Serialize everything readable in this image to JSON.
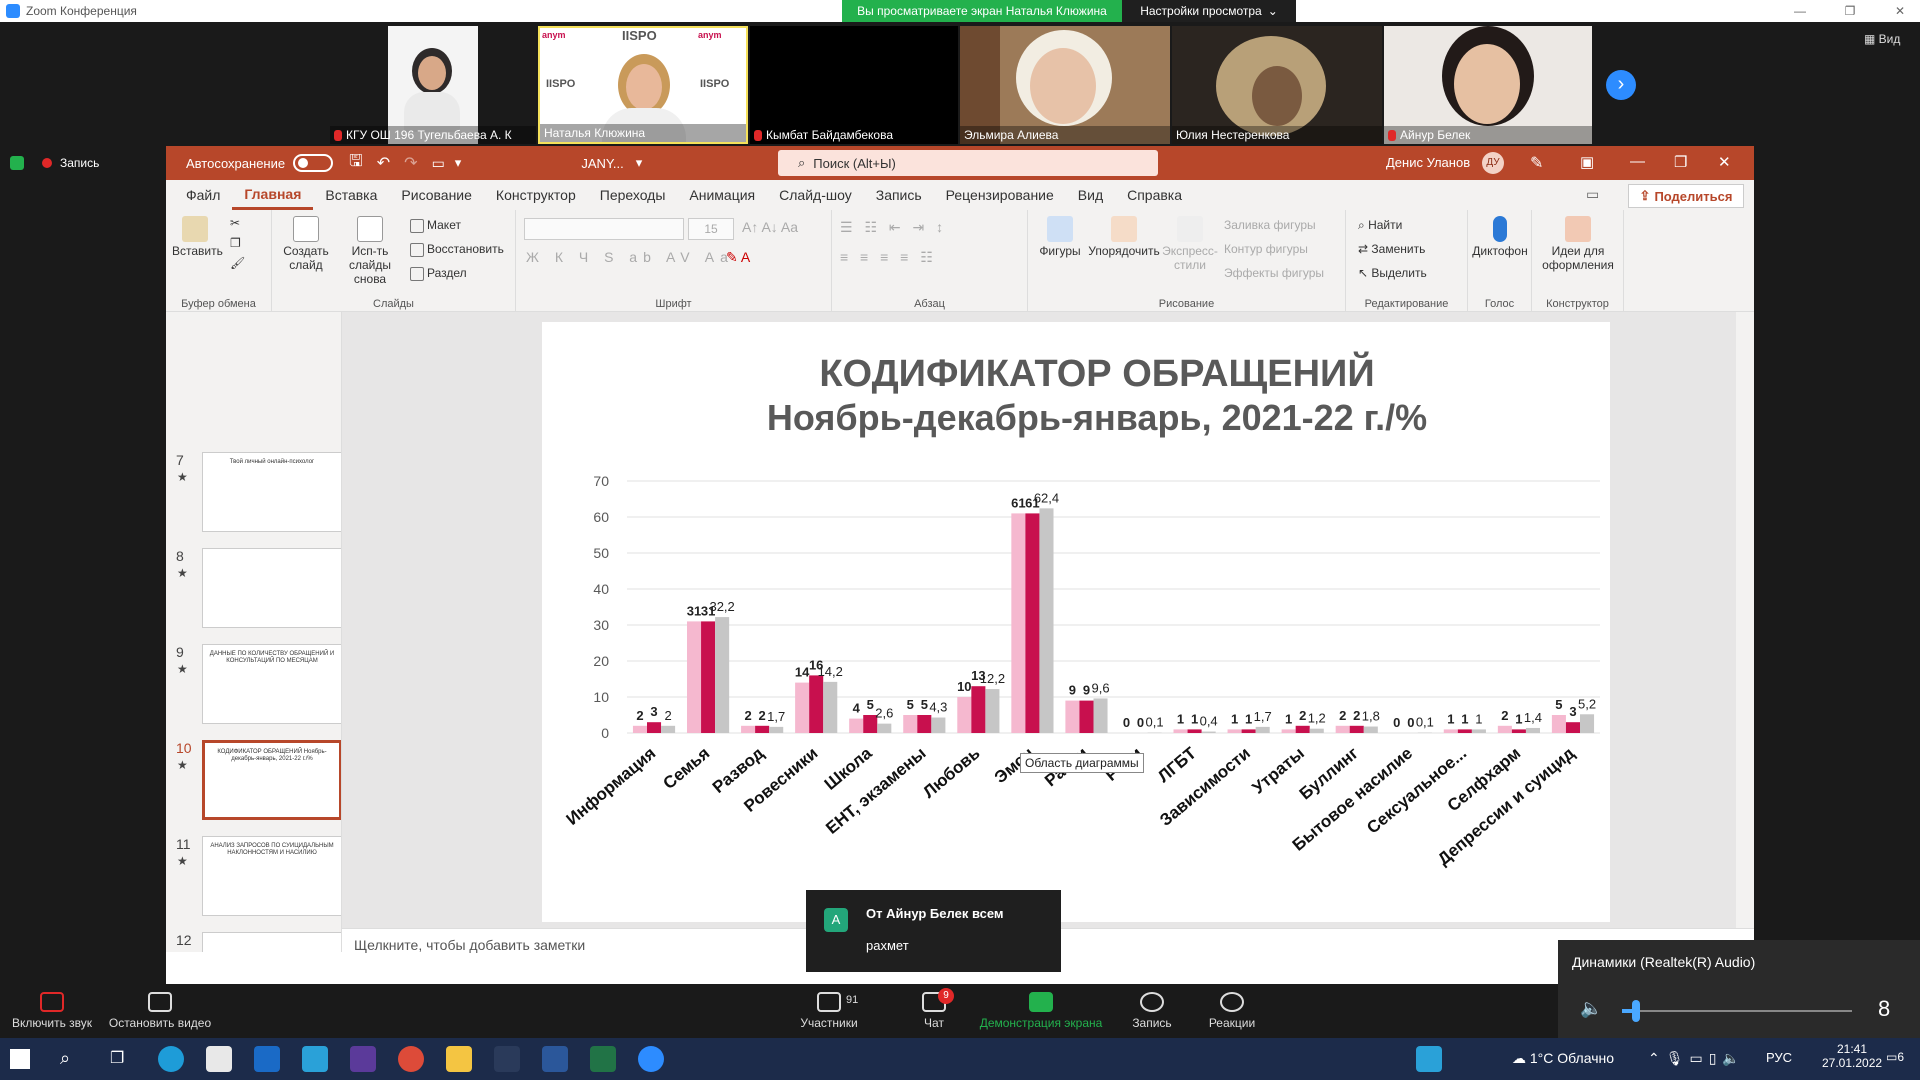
{
  "zoom": {
    "title": "Zoom Конференция",
    "viewing_banner": "Вы просматриваете экран Наталья Клюжина",
    "view_options": "Настройки просмотра",
    "view_button": "Вид",
    "record_label": "Запись",
    "participants": [
      {
        "name": "КГУ ОШ 196 Тугельбаева А. К",
        "muted": true
      },
      {
        "name": "Наталья Клюжина",
        "muted": false
      },
      {
        "name": "Кымбат Байдамбекова",
        "muted": true
      },
      {
        "name": "Эльмира Алиева",
        "muted": false
      },
      {
        "name": "Юлия Нестеренкова",
        "muted": false
      },
      {
        "name": "Айнур Белек",
        "muted": true
      }
    ],
    "tile_logo_text": "IISPO",
    "tile_logo_side": "anym",
    "bottom": {
      "mute": "Включить звук",
      "video": "Остановить видео",
      "participants": "Участники",
      "participants_count": "91",
      "chat": "Чат",
      "chat_badge": "9",
      "share": "Демонстрация экрана",
      "record": "Запись",
      "reactions": "Реакции"
    },
    "chat_popup": {
      "avatar": "А",
      "from": "От Айнур Белек всем",
      "message": "рахмет"
    },
    "audio_popup": {
      "device": "Динамики (Realtek(R) Audio)",
      "volume": "8",
      "level": 0.06
    }
  },
  "ppt": {
    "autosave": "Автосохранение",
    "filename": "JANY...",
    "search": "Поиск (Alt+Ы)",
    "user": "Денис Уланов",
    "user_initials": "ДУ",
    "share": "Поделиться",
    "menu": [
      "Файл",
      "Главная",
      "Вставка",
      "Рисование",
      "Конструктор",
      "Переходы",
      "Анимация",
      "Слайд-шоу",
      "Запись",
      "Рецензирование",
      "Вид",
      "Справка"
    ],
    "active_menu": 1,
    "ribbon": {
      "paste": "Вставить",
      "clipboard": "Буфер обмена",
      "new_slide": "Создать слайд",
      "reuse": "Исп-ть слайды снова",
      "layout": "Макет",
      "reset": "Восстановить",
      "section": "Раздел",
      "slides": "Слайды",
      "font_size": "15",
      "font": "Шрифт",
      "paragraph": "Абзац",
      "shapes": "Фигуры",
      "arrange": "Упорядочить",
      "quick_styles": "Экспресс-стили",
      "fill": "Заливка фигуры",
      "outline": "Контур фигуры",
      "effects": "Эффекты фигуры",
      "drawing": "Рисование",
      "find": "Найти",
      "replace": "Заменить",
      "select": "Выделить",
      "editing": "Редактирование",
      "dictate": "Диктофон",
      "voice": "Голос",
      "designer_ideas": "Идеи для оформления",
      "designer": "Конструктор"
    },
    "thumbs": [
      {
        "num": "7",
        "title": "Твой личный онлайн-психолог"
      },
      {
        "num": "8",
        "title": ""
      },
      {
        "num": "9",
        "title": "ДАННЫЕ ПО КОЛИЧЕСТВУ ОБРАЩЕНИЙ И КОНСУЛЬТАЦИЙ ПО МЕСЯЦАМ"
      },
      {
        "num": "10",
        "title": "КОДИФИКАТОР ОБРАЩЕНИЙ Ноябрь-декабрь-январь, 2021-22 г./%"
      },
      {
        "num": "11",
        "title": "АНАЛИЗ ЗАПРОСОВ ПО СУИЦИДАЛЬНЫМ НАКЛОННОСТЯМ И НАСИЛИЮ"
      },
      {
        "num": "12",
        "title": ""
      }
    ],
    "selected_thumb": "10",
    "notes": "Щелкните, чтобы добавить заметки",
    "tooltip": "Область диаграммы"
  },
  "chart_data": {
    "type": "bar",
    "title": "КОДИФИКАТОР ОБРАЩЕНИЙ",
    "subtitle": "Ноябрь-декабрь-январь, 2021-22 г./%",
    "ylim": [
      0,
      70
    ],
    "yticks": [
      0,
      10,
      20,
      30,
      40,
      50,
      60,
      70
    ],
    "grid": true,
    "categories": [
      "Информация",
      "Семья",
      "Развод",
      "Ровесники",
      "Школа",
      "ЕНТ, экзамены",
      "Любовь",
      "Эмоции",
      "Развитие",
      "Религия",
      "ЛГБТ",
      "Зависимости",
      "Утраты",
      "Буллинг",
      "Бытовое насилие",
      "Сексуальное...",
      "Селфхарм",
      "Депрессии и суицид"
    ],
    "category_labels": [
      "Информация",
      "Семья",
      "Развод",
      "Ровесники",
      "Школа",
      "ЕНТ, экзамены",
      "Любовь",
      "Эмоц",
      "Разви",
      "Рели",
      "ЛГБТ",
      "Зависимости",
      "Утраты",
      "Буллинг",
      "Бытовое насилие",
      "Сексуальное...",
      "Селфхарм",
      "Депрессии и суицид"
    ],
    "series": [
      {
        "values": [
          2,
          31,
          2,
          14,
          4,
          5,
          10,
          61,
          9,
          0,
          1,
          1,
          1,
          2,
          0,
          1,
          2,
          5
        ],
        "labels": [
          "2",
          "31",
          "2",
          "14",
          "4",
          "5",
          "10",
          "61",
          "9",
          "0",
          "1",
          "1",
          "1",
          "2",
          "0",
          "1",
          "2",
          "5"
        ],
        "color": "#f5b8cf"
      },
      {
        "values": [
          3,
          31,
          2,
          16,
          5,
          5,
          13,
          61,
          9,
          0,
          1,
          1,
          2,
          2,
          0,
          1,
          1,
          3
        ],
        "labels": [
          "3",
          "31",
          "2",
          "16",
          "5",
          "5",
          "13",
          "61",
          "9",
          "0",
          "1",
          "1",
          "2",
          "2",
          "0",
          "1",
          "1",
          "3"
        ],
        "color": "#c8104e"
      },
      {
        "values": [
          2,
          32.2,
          1.7,
          14.2,
          2.6,
          4.3,
          12.2,
          62.4,
          9.6,
          0.1,
          0.4,
          1.7,
          1.2,
          1.8,
          0.1,
          1,
          1.4,
          5.2
        ],
        "labels": [
          "2",
          "32,2",
          "1,7",
          "14,2",
          "2,6",
          "4,3",
          "12,2",
          "62,4",
          "9,6",
          "0,1",
          "0,4",
          "1,7",
          "1,2",
          "1,8",
          "0,1",
          "1",
          "1,4",
          "5,2"
        ],
        "color": "#c6c6c6"
      }
    ]
  },
  "taskbar": {
    "weather": "1°C Облачно",
    "lang": "РУС",
    "time": "21:41",
    "date": "27.01.2022",
    "notif": "6"
  }
}
